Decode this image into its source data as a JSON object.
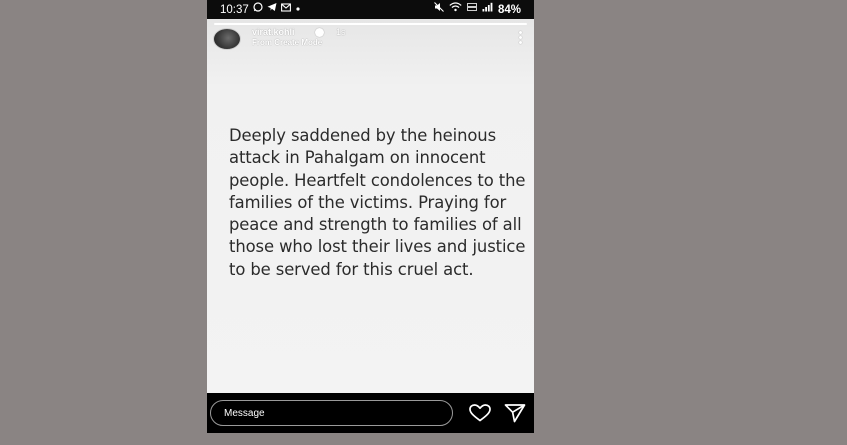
{
  "status_bar": {
    "time": "10:37",
    "battery": "84%",
    "left_icons": [
      "whatsapp-icon",
      "telegram-icon",
      "gmail-icon",
      "dot-icon"
    ],
    "right_icons": [
      "mute-icon",
      "wifi-icon",
      "signal-icon"
    ]
  },
  "story": {
    "username": "virat.kohli",
    "time_ago": "1s",
    "subtitle": "From Create Mode",
    "text": "Deeply saddened by the heinous attack in Pahalgam on innocent people. Heartfelt condolences to the families of the victims. Praying for peace and strength to families of all those who lost their lives and justice to be served for this cruel act."
  },
  "reply_bar": {
    "message_placeholder": "Message"
  },
  "colors": {
    "page_background": "#8a8483",
    "story_background": "#f1f1f1",
    "story_text": "#2b2b2b",
    "bar_background": "#000000"
  }
}
